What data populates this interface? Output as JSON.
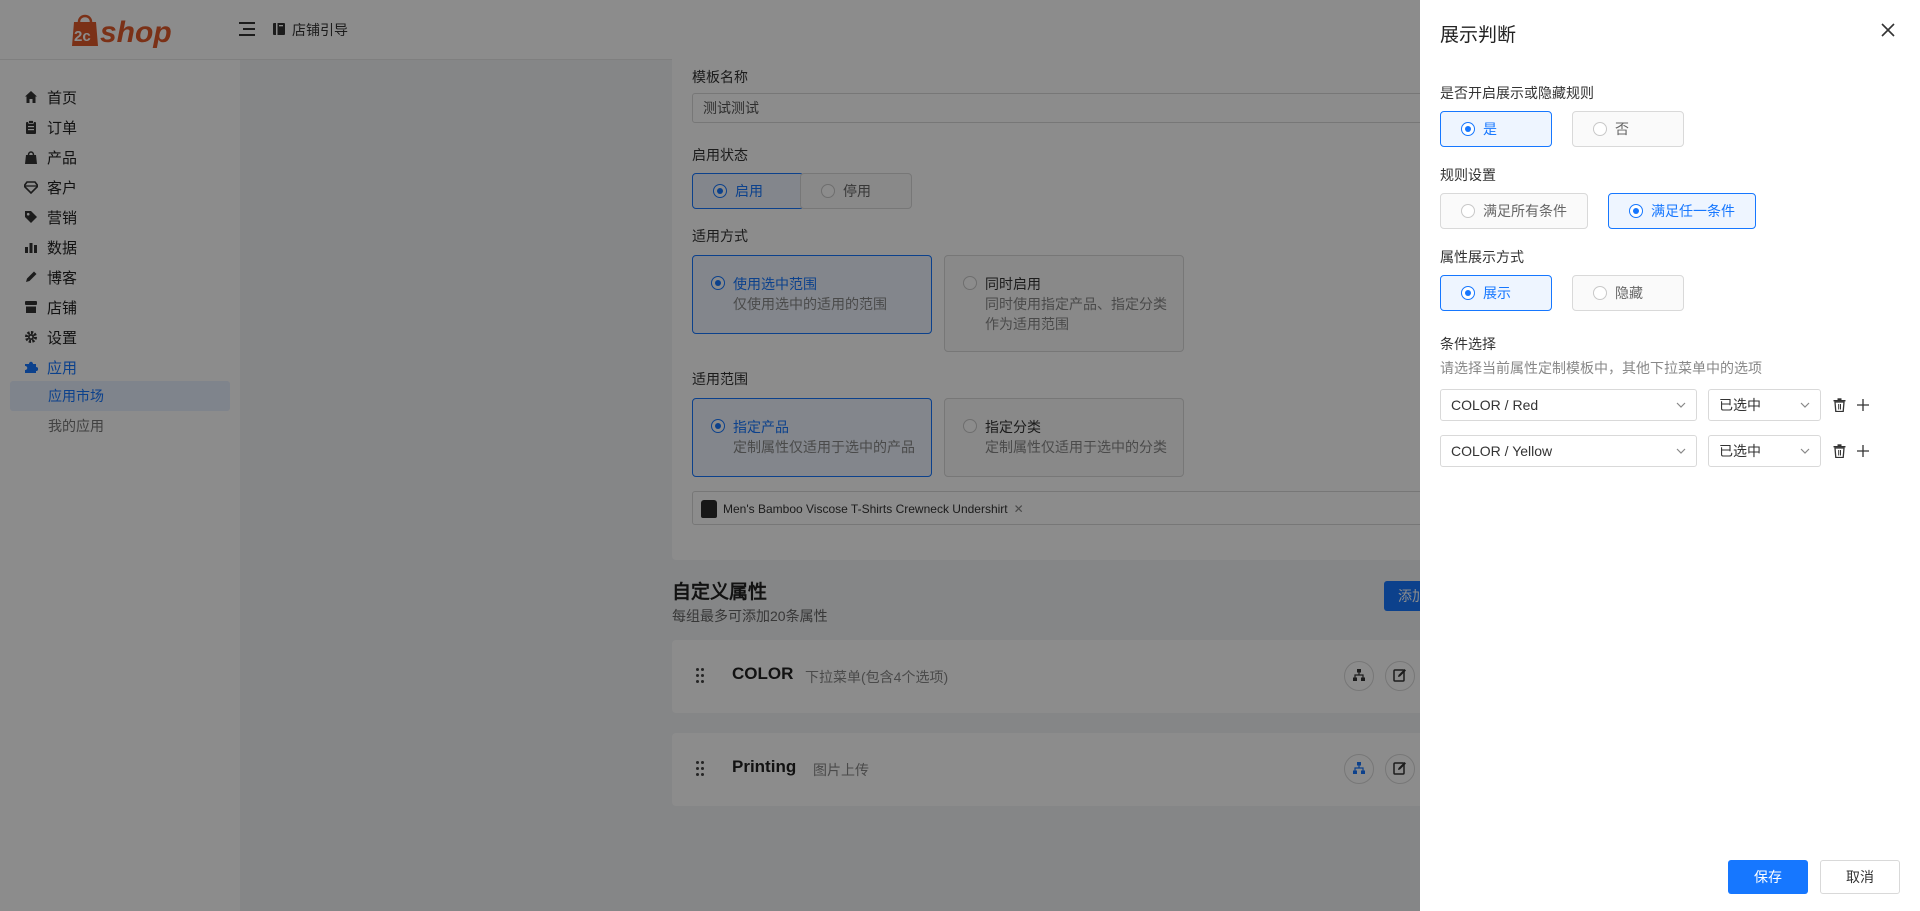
{
  "header": {
    "logo_text": "2cshop",
    "guide_label": "店铺引导"
  },
  "sidebar": {
    "items": [
      {
        "label": "首页",
        "icon": "home-icon"
      },
      {
        "label": "订单",
        "icon": "clipboard-icon"
      },
      {
        "label": "产品",
        "icon": "bag-icon"
      },
      {
        "label": "客户",
        "icon": "diamond-icon"
      },
      {
        "label": "营销",
        "icon": "tag-icon"
      },
      {
        "label": "数据",
        "icon": "bar-chart-icon"
      },
      {
        "label": "博客",
        "icon": "pen-icon"
      },
      {
        "label": "店铺",
        "icon": "store-icon"
      },
      {
        "label": "设置",
        "icon": "gear-icon"
      },
      {
        "label": "应用",
        "icon": "puzzle-icon"
      }
    ],
    "sub_items": [
      {
        "label": "应用市场"
      },
      {
        "label": "我的应用"
      }
    ]
  },
  "main": {
    "template_name_label": "模板名称",
    "template_name_value": "测试测试",
    "status_label": "启用状态",
    "status_options": [
      "启用",
      "停用"
    ],
    "apply_mode_label": "适用方式",
    "apply_mode_options": [
      {
        "title": "使用选中范围",
        "desc": "仅使用选中的适用的范围"
      },
      {
        "title": "同时启用",
        "desc": "同时使用指定产品、指定分类",
        "desc2": "作为适用范围"
      }
    ],
    "scope_label": "适用范围",
    "scope_options": [
      {
        "title": "指定产品",
        "desc": "定制属性仅适用于选中的产品"
      },
      {
        "title": "指定分类",
        "desc": "定制属性仅适用于选中的分类"
      }
    ],
    "product_tag": "Men's Bamboo Viscose T-Shirts Crewneck Undershirt",
    "custom_attr_title": "自定义属性",
    "custom_attr_sub": "每组最多可添加20条属性",
    "add_button": "添加",
    "attributes": [
      {
        "name": "COLOR",
        "type": "下拉菜单(包含4个选项)"
      },
      {
        "name": "Printing",
        "type": "图片上传"
      }
    ]
  },
  "drawer": {
    "title": "展示判断",
    "enable_label": "是否开启展示或隐藏规则",
    "enable_options": [
      "是",
      "否"
    ],
    "rule_label": "规则设置",
    "rule_options": [
      "满足所有条件",
      "满足任一条件"
    ],
    "display_label": "属性展示方式",
    "display_options": [
      "展示",
      "隐藏"
    ],
    "condition_label": "条件选择",
    "condition_help": "请选择当前属性定制模板中，其他下拉菜单中的选项",
    "conditions": [
      {
        "option": "COLOR / Red",
        "state": "已选中"
      },
      {
        "option": "COLOR / Yellow",
        "state": "已选中"
      }
    ],
    "save_label": "保存",
    "cancel_label": "取消"
  },
  "colors": {
    "accent": "#1677ff",
    "overlay": "rgba(0,0,0,0.45)"
  }
}
